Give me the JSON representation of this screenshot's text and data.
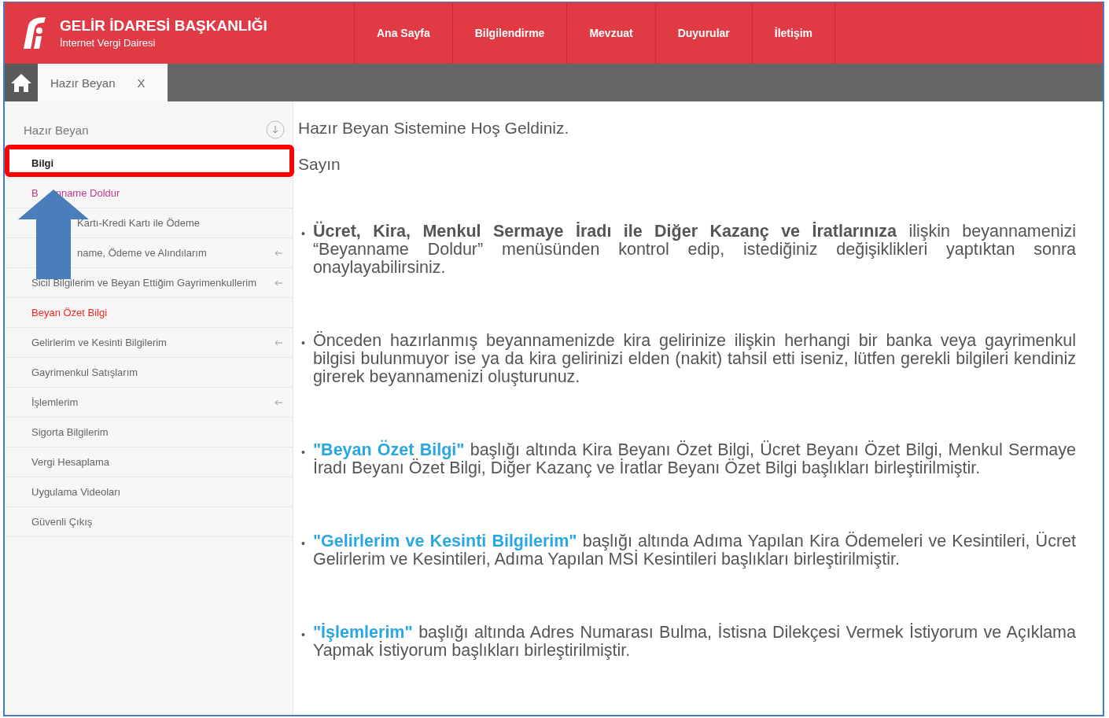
{
  "header": {
    "title": "GELİR İDARESİ BAŞKANLIĞI",
    "subtitle": "İnternet Vergi Dairesi",
    "nav": [
      "Ana Sayfa",
      "Bilgilendirme",
      "Mevzuat",
      "Duyurular",
      "İletişim"
    ]
  },
  "tabs": [
    {
      "label": "Hazır Beyan",
      "close": "X",
      "selected": true
    }
  ],
  "sidebar": {
    "heading": "Hazır Beyan",
    "items": [
      {
        "kind": "normal",
        "text": "Bilgi",
        "selected": true,
        "color": "#222222",
        "arrow": false
      },
      {
        "kind": "split",
        "lead": "B",
        "text": "nname Doldur",
        "selected": false,
        "color": "#c8368a",
        "arrow": false
      },
      {
        "kind": "hidden-start",
        "text": "Kartı-Kredi Kartı ile Ödeme",
        "selected": false,
        "color": "#666666",
        "arrow": false
      },
      {
        "kind": "hidden-start",
        "text": "name, Ödeme ve Alındılarım",
        "selected": false,
        "color": "#666666",
        "arrow": true
      },
      {
        "kind": "normal",
        "text": "Sicil Bilgilerim ve Beyan Ettiğim Gayrimenkullerim",
        "selected": false,
        "color": "#666666",
        "arrow": true
      },
      {
        "kind": "normal",
        "text": "Beyan Özet Bilgi",
        "selected": false,
        "color": "#ff2222",
        "arrow": false
      },
      {
        "kind": "normal",
        "text": "Gelirlerim ve Kesinti Bilgilerim",
        "selected": false,
        "color": "#666666",
        "arrow": true
      },
      {
        "kind": "normal",
        "text": "Gayrimenkul Satışlarım",
        "selected": false,
        "color": "#666666",
        "arrow": false
      },
      {
        "kind": "normal",
        "text": "İşlemlerim",
        "selected": false,
        "color": "#666666",
        "arrow": true
      },
      {
        "kind": "normal",
        "text": "Sigorta Bilgilerim",
        "selected": false,
        "color": "#666666",
        "arrow": false
      },
      {
        "kind": "normal",
        "text": "Vergi Hesaplama",
        "selected": false,
        "color": "#666666",
        "arrow": false
      },
      {
        "kind": "normal",
        "text": "Uygulama Videoları",
        "selected": false,
        "color": "#666666",
        "arrow": false
      },
      {
        "kind": "normal",
        "text": "Güvenli Çıkış",
        "selected": false,
        "color": "#666666",
        "arrow": false
      }
    ]
  },
  "main": {
    "title": "Hazır Beyan Sistemine Hoş Geldiniz.",
    "greeting": "Sayın",
    "bullets": [
      {
        "marker": "•",
        "parts": [
          {
            "kind": "bold",
            "text": "Ücret, Kira, Menkul Sermaye İradı ile Diğer Kazanç ve İratlarınıza"
          },
          {
            "kind": "plain",
            "text": " ilişkin beyannamenizi “Beyanname Doldur” menüsünden kontrol edip, istediğiniz değişiklikleri yaptıktan sonra onaylayabilirsiniz."
          }
        ]
      },
      {
        "marker": "•",
        "parts": [
          {
            "kind": "plain",
            "text": "Önceden hazırlanmış beyannamenizde kira gelirinize ilişkin herhangi bir banka veya gayrimenkul bilgisi bulunmuyor ise ya da kira gelirinizi elden (nakit) tahsil etti iseniz, lütfen gerekli bilgileri kendiniz girerek beyannamenizi oluşturunuz."
          }
        ]
      },
      {
        "marker": "•",
        "parts": [
          {
            "kind": "link",
            "text": "\"Beyan Özet Bilgi\""
          },
          {
            "kind": "plain",
            "text": " başlığı altında Kira Beyanı Özet Bilgi, Ücret Beyanı Özet Bilgi, Menkul Sermaye İradı Beyanı Özet Bilgi, Diğer Kazanç ve İratlar Beyanı Özet Bilgi başlıkları birleştirilmiştir."
          }
        ]
      },
      {
        "marker": "•",
        "parts": [
          {
            "kind": "link",
            "text": "\"Gelirlerim ve Kesinti Bilgilerim\""
          },
          {
            "kind": "plain",
            "text": " başlığı altında Adıma Yapılan Kira Ödemeleri ve Kesintileri, Ücret Gelirlerim ve Kesintileri, Adıma Yapılan MSİ Kesintileri başlıkları birleştirilmiştir."
          }
        ]
      },
      {
        "marker": "•",
        "parts": [
          {
            "kind": "link",
            "text": "\"İşlemlerim\""
          },
          {
            "kind": "plain",
            "text": " başlığı altında Adres Numarası Bulma, İstisna Dilekçesi Vermek İstiyorum ve Açıklama Yapmak İstiyorum başlıkları birleştirilmiştir."
          }
        ]
      }
    ]
  }
}
